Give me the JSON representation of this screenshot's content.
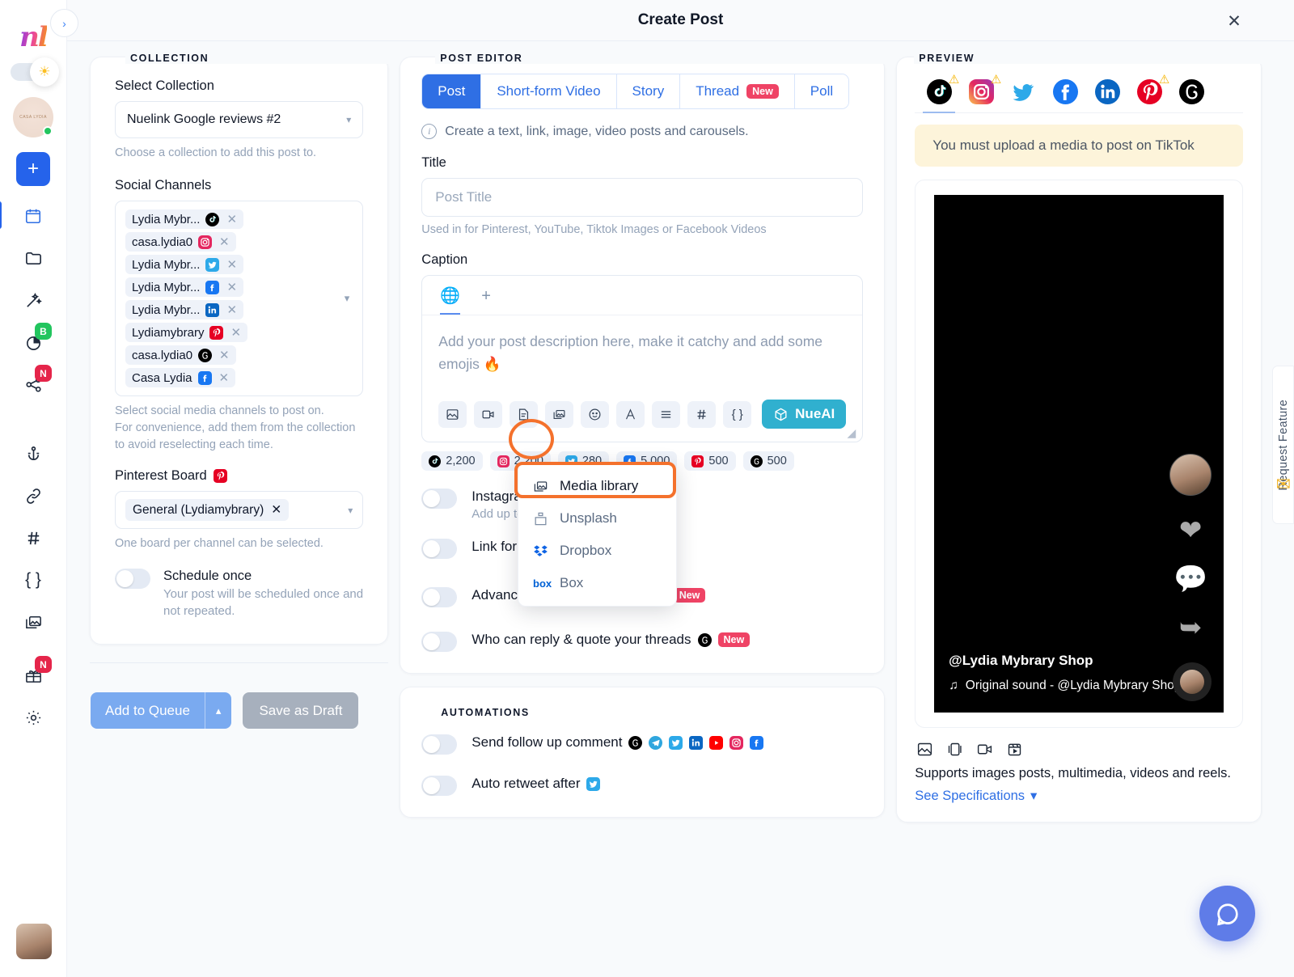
{
  "header": {
    "title": "Create Post",
    "close_label": "✕"
  },
  "rail": {
    "logo": "nl",
    "items": [
      {
        "name": "calendar",
        "badge": null
      },
      {
        "name": "folder",
        "badge": null
      },
      {
        "name": "magic-wand",
        "badge": null
      },
      {
        "name": "analytics",
        "badge": "B",
        "badge_color": "#22c55e"
      },
      {
        "name": "share",
        "badge": "N",
        "badge_color": "#e5254a"
      },
      {
        "name": "anchor",
        "badge": null
      },
      {
        "name": "link",
        "badge": null
      },
      {
        "name": "hashtag",
        "badge": null
      },
      {
        "name": "braces",
        "badge": null
      },
      {
        "name": "media-library",
        "badge": null
      },
      {
        "name": "gift",
        "badge": "N",
        "badge_color": "#e5254a"
      },
      {
        "name": "settings",
        "badge": null
      }
    ],
    "add_label": "+",
    "avatar_text": "CASA LYDIA"
  },
  "collection": {
    "section_label": "COLLECTION",
    "select_collection_label": "Select Collection",
    "selected_collection": "Nuelink Google reviews #2",
    "collection_hint": "Choose a collection to add this post to.",
    "social_channels_label": "Social Channels",
    "channels": [
      {
        "name": "Lydia Mybr...",
        "platform": "tiktok"
      },
      {
        "name": "casa.lydia0",
        "platform": "instagram"
      },
      {
        "name": "Lydia Mybr...",
        "platform": "twitter"
      },
      {
        "name": "Lydia Mybr...",
        "platform": "facebook"
      },
      {
        "name": "Lydia Mybr...",
        "platform": "linkedin"
      },
      {
        "name": "Lydiamybrary",
        "platform": "pinterest"
      },
      {
        "name": "casa.lydia0",
        "platform": "threads"
      },
      {
        "name": "Casa Lydia",
        "platform": "facebook"
      }
    ],
    "channels_hint_1": "Select social media channels to post on.",
    "channels_hint_2": "For convenience, add them from the collection to avoid reselecting each time.",
    "pinterest_board_label": "Pinterest Board",
    "pinterest_board_value": "General (Lydiamybrary)",
    "pinterest_board_hint": "One board per channel can be selected.",
    "schedule_once_title": "Schedule once",
    "schedule_once_sub": "Your post will be scheduled once and not repeated.",
    "add_to_queue_label": "Add to Queue",
    "save_as_draft_label": "Save as Draft"
  },
  "editor": {
    "section_label": "POST EDITOR",
    "tabs": [
      {
        "label": "Post",
        "active": true,
        "badge": null
      },
      {
        "label": "Short-form Video",
        "active": false,
        "badge": null
      },
      {
        "label": "Story",
        "active": false,
        "badge": null
      },
      {
        "label": "Thread",
        "active": false,
        "badge": "New"
      },
      {
        "label": "Poll",
        "active": false,
        "badge": null
      }
    ],
    "info_text": "Create a text, link, image, video posts and carousels.",
    "title_label": "Title",
    "title_placeholder": "Post Title",
    "title_hint": "Used in for Pinterest, YouTube, Tiktok Images or Facebook Videos",
    "caption_label": "Caption",
    "caption_tabs": [
      "globe-icon",
      "plus-icon"
    ],
    "caption_placeholder": "Add your post description here, make it catchy and add some emojis 🔥",
    "toolbar": [
      {
        "name": "image-icon"
      },
      {
        "name": "video-icon"
      },
      {
        "name": "document-icon"
      },
      {
        "name": "media-library-icon"
      },
      {
        "name": "emoji-icon"
      },
      {
        "name": "font-icon"
      },
      {
        "name": "align-icon"
      },
      {
        "name": "hashtag-icon"
      },
      {
        "name": "braces-icon"
      }
    ],
    "nueai_label": "NueAI",
    "counts": [
      {
        "platform": "tiktok",
        "value": "2,200"
      },
      {
        "platform": "instagram",
        "value": "2,200"
      },
      {
        "platform": "twitter",
        "value": "280"
      },
      {
        "platform": "facebook",
        "value": "5,000"
      },
      {
        "platform": "pinterest",
        "value": "500"
      },
      {
        "platform": "threads",
        "value": "500"
      }
    ],
    "media_menu": [
      {
        "label": "Media library",
        "icon": "media-library-icon",
        "highlighted": true
      },
      {
        "label": "Unsplash",
        "icon": "unsplash-icon",
        "highlighted": false
      },
      {
        "label": "Dropbox",
        "icon": "dropbox-icon",
        "highlighted": false
      },
      {
        "label": "Box",
        "icon": "box-icon",
        "highlighted": false
      }
    ],
    "options": [
      {
        "title": "Instagram",
        "sub": "Add up to ... for your Instagram post.",
        "badge": null,
        "platform": null
      },
      {
        "title": "Link for P",
        "sub": null,
        "badge": null,
        "platform": null
      },
      {
        "title": "Advanced Options for TikTok",
        "sub": null,
        "badge": "New",
        "platform": "tiktok"
      },
      {
        "title": "Who can reply & quote your threads",
        "sub": null,
        "badge": "New",
        "platform": "threads"
      }
    ]
  },
  "automations": {
    "section_label": "AUTOMATIONS",
    "rows": [
      {
        "label": "Send follow up comment",
        "platforms": [
          "threads",
          "telegram",
          "twitter",
          "linkedin",
          "youtube",
          "instagram",
          "facebook"
        ]
      },
      {
        "label": "Auto retweet after",
        "platforms": [
          "twitter"
        ]
      }
    ]
  },
  "preview": {
    "section_label": "PREVIEW",
    "platform_tabs": [
      {
        "platform": "tiktok",
        "warning": true,
        "selected": true
      },
      {
        "platform": "instagram",
        "warning": true,
        "selected": false
      },
      {
        "platform": "twitter",
        "warning": false,
        "selected": false
      },
      {
        "platform": "facebook",
        "warning": false,
        "selected": false
      },
      {
        "platform": "linkedin",
        "warning": false,
        "selected": false
      },
      {
        "platform": "pinterest",
        "warning": true,
        "selected": false
      },
      {
        "platform": "threads",
        "warning": false,
        "selected": false
      }
    ],
    "alert_text": "You must upload a media to post on TikTok",
    "handle": "@Lydia Mybrary Shop",
    "sound": "Original sound - @Lydia Mybrary Shop",
    "supports_text": "Supports images posts, multimedia, videos and reels.",
    "see_specifications": "See Specifications"
  },
  "request_feature": {
    "label": "Request Feature"
  },
  "colors": {
    "accent_blue": "#2f6fe4",
    "highlight_orange": "#f4712c",
    "nueai_teal": "#30b0cf",
    "badge_red": "#ef4365",
    "badge_green": "#22c55e",
    "alert_bg": "#fdf4da"
  }
}
